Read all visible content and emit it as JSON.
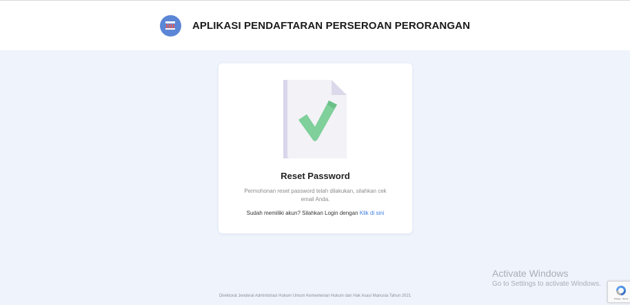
{
  "header": {
    "title": "APLIKASI PENDAFTARAN PERSEROAN PERORANGAN",
    "logo_icon": "government-building-icon"
  },
  "card": {
    "illustration_icon": "document-check-icon",
    "title": "Reset Password",
    "message": "Permohonan reset password telah dilakukan, silahkan cek email Anda.",
    "login_prompt": "Sudah memiliki akun? Silahkan Login dengan",
    "login_link": "Klik di sini"
  },
  "footer": {
    "text": "Direktorat Jenderal Administrasi Hukum Umum Kementerian Hukum dan Hak Asasi Manusia Tahun 2021"
  },
  "watermark": {
    "title": "Activate Windows",
    "subtitle": "Go to Settings to activate Windows."
  },
  "recaptcha": {
    "icon": "recaptcha-icon",
    "terms": "Privacy - Terms"
  },
  "colors": {
    "background": "#eff3fc",
    "link": "#3b7de0",
    "check": "#7fd09a"
  }
}
